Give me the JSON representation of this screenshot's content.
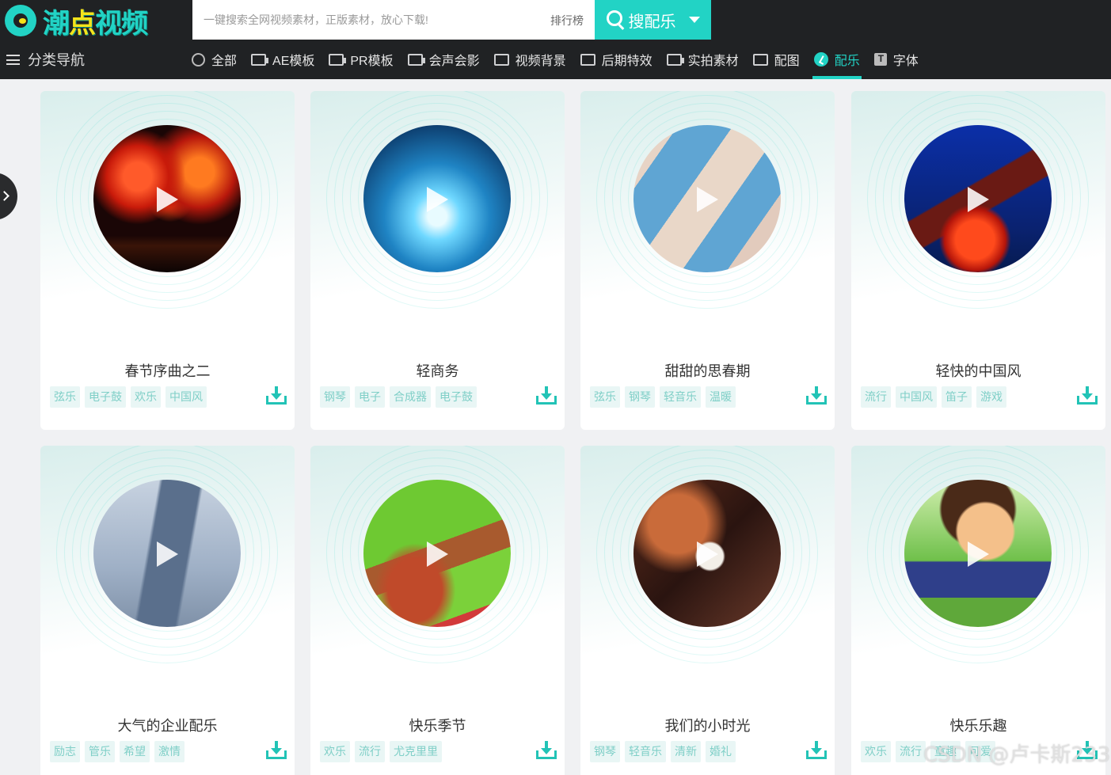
{
  "brand": {
    "logo_text_a": "潮",
    "logo_text_b": "点",
    "logo_text_c": "视频"
  },
  "search": {
    "placeholder": "一键搜索全网视频素材，正版素材，放心下载!",
    "rank_label": "排行榜",
    "button_label": "搜配乐"
  },
  "category_nav": {
    "label": "分类导航"
  },
  "nav": [
    {
      "label": "全部",
      "icon": "search-icon"
    },
    {
      "label": "AE模板",
      "icon": "film-icon"
    },
    {
      "label": "PR模板",
      "icon": "film-icon"
    },
    {
      "label": "会声会影",
      "icon": "film-icon"
    },
    {
      "label": "视频背景",
      "icon": "image-icon"
    },
    {
      "label": "后期特效",
      "icon": "image-icon"
    },
    {
      "label": "实拍素材",
      "icon": "camera-icon"
    },
    {
      "label": "配图",
      "icon": "picture-icon"
    },
    {
      "label": "配乐",
      "icon": "music-note-icon",
      "active": true
    },
    {
      "label": "字体",
      "icon": "font-icon"
    }
  ],
  "cards": [
    {
      "title": "春节序曲之二",
      "tags": [
        "弦乐",
        "电子鼓",
        "欢乐",
        "中国风"
      ],
      "art": "fireworks"
    },
    {
      "title": "轻商务",
      "tags": [
        "钢琴",
        "电子",
        "合成器",
        "电子鼓"
      ],
      "art": "tech"
    },
    {
      "title": "甜甜的思春期",
      "tags": [
        "弦乐",
        "钢琴",
        "轻音乐",
        "温暖"
      ],
      "art": "sweets"
    },
    {
      "title": "轻快的中国风",
      "tags": [
        "流行",
        "中国风",
        "笛子",
        "游戏"
      ],
      "art": "lantern"
    },
    {
      "title": "大气的企业配乐",
      "tags": [
        "励志",
        "管乐",
        "希望",
        "激情"
      ],
      "art": "skyscraper"
    },
    {
      "title": "快乐季节",
      "tags": [
        "欢乐",
        "流行",
        "尤克里里"
      ],
      "art": "garden"
    },
    {
      "title": "我们的小时光",
      "tags": [
        "钢琴",
        "轻音乐",
        "清新",
        "婚礼"
      ],
      "art": "charm"
    },
    {
      "title": "快乐乐趣",
      "tags": [
        "欢乐",
        "流行",
        "童趣",
        "可爱"
      ],
      "art": "cartoon"
    }
  ],
  "watermark": "CSDN @卢卡斯233"
}
